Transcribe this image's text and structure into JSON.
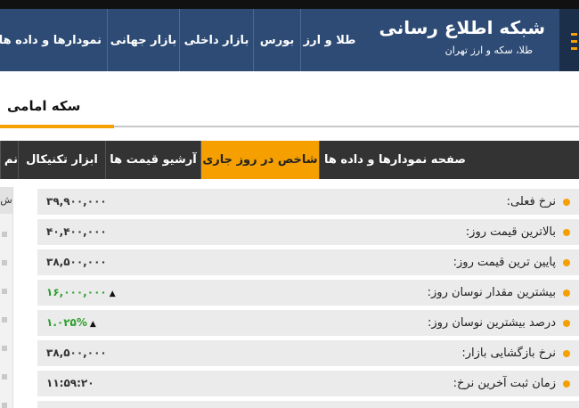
{
  "header": {
    "title": "شبکه اطلاع رسانی",
    "subtitle": "طلا، سکه و ارز تهران",
    "nav": [
      "طلا و ارز",
      "بورس",
      "بازار داخلی",
      "بازار جهانی",
      "نمودارها و داده ها"
    ]
  },
  "section": {
    "title": "سکه امامی"
  },
  "tabs": [
    "صفحه نمودارها و داده ها",
    "شاخص در روز جاری",
    "آرشیو قیمت ها",
    "ابزار تکنیکال",
    "نم"
  ],
  "left_panel": {
    "header": "ش"
  },
  "rows": [
    {
      "label": "نرخ فعلی:",
      "value": "۳۹,۹۰۰,۰۰۰"
    },
    {
      "label": "بالاترین قیمت روز:",
      "value": "۴۰,۴۰۰,۰۰۰"
    },
    {
      "label": "پایین ترین قیمت روز:",
      "value": "۳۸,۵۰۰,۰۰۰"
    },
    {
      "label": "بیشترین مقدار نوسان روز:",
      "value": "۱۶,۰۰۰,۰۰۰",
      "arrow": "▲"
    },
    {
      "label": "درصد بیشترین نوسان روز:",
      "value": "۱.۰۲۵%",
      "arrow": "▲"
    },
    {
      "label": "نرخ بازگشایی بازار:",
      "value": "۳۸,۵۰۰,۰۰۰"
    },
    {
      "label": "زمان ثبت آخرین نرخ:",
      "value": "۱۱:۵۹:۲۰"
    }
  ],
  "colors": {
    "header_bg": "#2d4b74",
    "accent": "#f5a000",
    "tabs_bg": "#333333",
    "positive": "#2e9e2e"
  }
}
